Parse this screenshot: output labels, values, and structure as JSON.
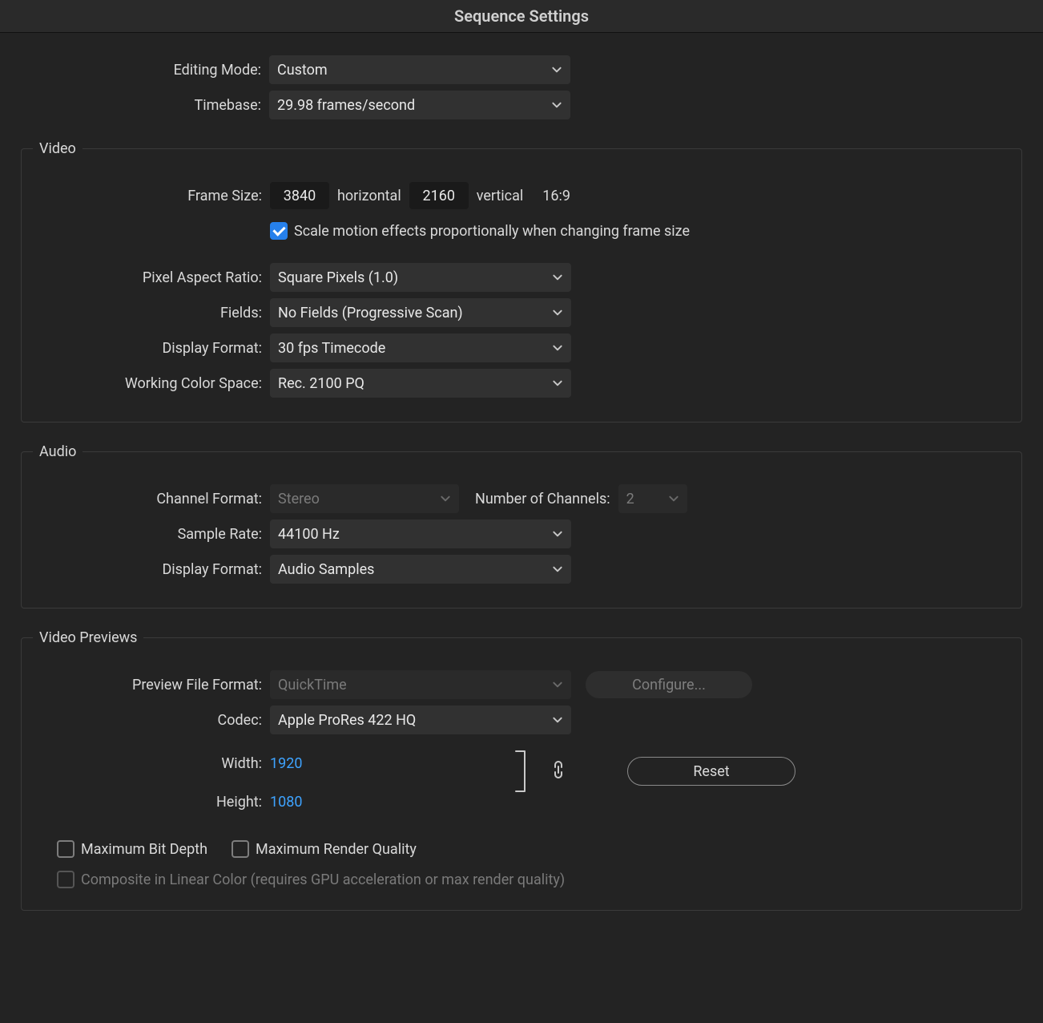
{
  "title": "Sequence Settings",
  "labels": {
    "editingMode": "Editing Mode:",
    "timebase": "Timebase:",
    "frameSize": "Frame Size:",
    "horizontal": "horizontal",
    "vertical": "vertical",
    "aspect": "16:9",
    "scaleMotion": "Scale motion effects proportionally when changing frame size",
    "pixelAspect": "Pixel Aspect Ratio:",
    "fields": "Fields:",
    "videoDisplayFormat": "Display Format:",
    "workingColor": "Working Color Space:",
    "channelFormat": "Channel Format:",
    "numChannels": "Number of Channels:",
    "sampleRate": "Sample Rate:",
    "audioDisplayFormat": "Display Format:",
    "previewFileFormat": "Preview File Format:",
    "configure": "Configure...",
    "codec": "Codec:",
    "width": "Width:",
    "height": "Height:",
    "reset": "Reset",
    "maxBitDepth": "Maximum Bit Depth",
    "maxRenderQuality": "Maximum Render Quality",
    "composite": "Composite in Linear Color (requires GPU acceleration or max render quality)"
  },
  "groups": {
    "video": "Video",
    "audio": "Audio",
    "previews": "Video Previews"
  },
  "values": {
    "editingMode": "Custom",
    "timebase": "29.98  frames/second",
    "frameWidth": "3840",
    "frameHeight": "2160",
    "scaleMotionChecked": true,
    "pixelAspect": "Square Pixels (1.0)",
    "fields": "No Fields (Progressive Scan)",
    "videoDisplayFormat": "30 fps Timecode",
    "workingColor": "Rec. 2100 PQ",
    "channelFormat": "Stereo",
    "numChannels": "2",
    "sampleRate": "44100 Hz",
    "audioDisplayFormat": "Audio Samples",
    "previewFileFormat": "QuickTime",
    "codec": "Apple ProRes 422 HQ",
    "previewWidth": "1920",
    "previewHeight": "1080",
    "maxBitDepthChecked": false,
    "maxRenderQualityChecked": false,
    "compositeChecked": false
  }
}
